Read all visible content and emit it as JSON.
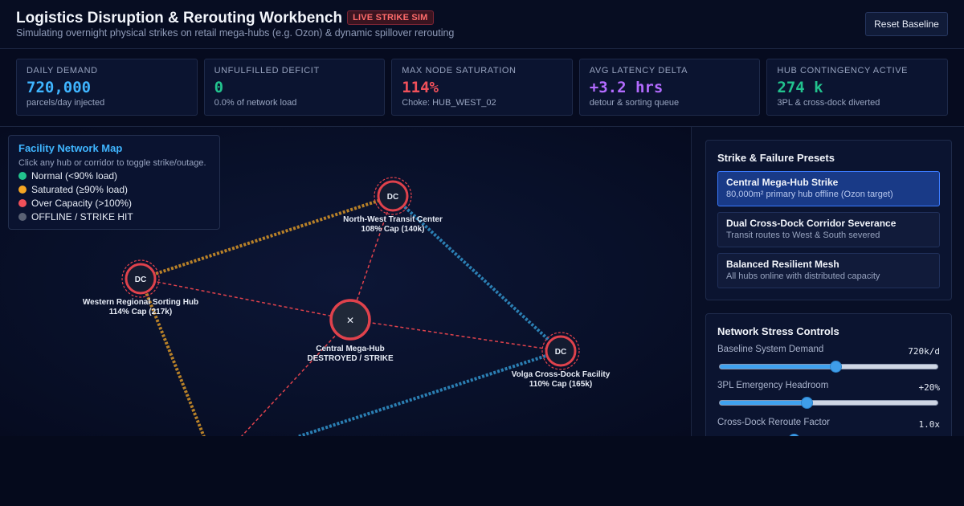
{
  "header": {
    "title": "Logistics Disruption & Rerouting Workbench",
    "badge": "LIVE STRIKE SIM",
    "subtitle": "Simulating overnight physical strikes on retail mega-hubs (e.g. Ozon) & dynamic spillover rerouting",
    "reset_label": "Reset Baseline"
  },
  "kpis": [
    {
      "label": "DAILY DEMAND",
      "value": "720,000",
      "sub": "parcels/day injected",
      "color": "#3fb5ff"
    },
    {
      "label": "UNFULFILLED DEFICIT",
      "value": "0",
      "sub": "0.0% of network load",
      "color": "#22c38e"
    },
    {
      "label": "MAX NODE SATURATION",
      "value": "114%",
      "sub": "Choke: HUB_WEST_02",
      "color": "#f0505a"
    },
    {
      "label": "AVG LATENCY DELTA",
      "value": "+3.2 hrs",
      "sub": "detour & sorting queue",
      "color": "#b36bff"
    },
    {
      "label": "HUB CONTINGENCY ACTIVE",
      "value": "274 k",
      "sub": "3PL & cross-dock diverted",
      "color": "#22c38e"
    }
  ],
  "legend": {
    "title": "Facility Network Map",
    "hint": "Click any hub or corridor to toggle strike/outage.",
    "items": [
      {
        "label": "Normal (<90% load)",
        "color": "#22c38e"
      },
      {
        "label": "Saturated (≥90% load)",
        "color": "#f5a623"
      },
      {
        "label": "Over Capacity (>100%)",
        "color": "#f0505a"
      },
      {
        "label": "OFFLINE / STRIKE HIT",
        "color": "#5a6275"
      }
    ]
  },
  "nodes": [
    {
      "id": "nw",
      "glyph": "DC",
      "name": "North-West Transit Center",
      "status": "108% Cap (140k)"
    },
    {
      "id": "west",
      "glyph": "DC",
      "name": "Western Regional Sorting Hub",
      "status": "114% Cap (217k)"
    },
    {
      "id": "central",
      "glyph": "✕",
      "name": "Central Mega-Hub",
      "status": "DESTROYED / STRIKE"
    },
    {
      "id": "volga",
      "glyph": "DC",
      "name": "Volga Cross-Dock Facility",
      "status": "110% Cap (165k)"
    }
  ],
  "presets": {
    "title": "Strike & Failure Presets",
    "items": [
      {
        "name": "Central Mega-Hub Strike",
        "desc": "80,000m² primary hub offline (Ozon target)",
        "active": true
      },
      {
        "name": "Dual Cross-Dock Corridor Severance",
        "desc": "Transit routes to West & South severed",
        "active": false
      },
      {
        "name": "Balanced Resilient Mesh",
        "desc": "All hubs online with distributed capacity",
        "active": false
      }
    ]
  },
  "controls": {
    "title": "Network Stress Controls",
    "sliders": [
      {
        "label": "Baseline System Demand",
        "value": "720k/d",
        "level": 0.53
      },
      {
        "label": "3PL Emergency Headroom",
        "value": "+20%",
        "level": 0.4
      },
      {
        "label": "Cross-Dock Reroute Factor",
        "value": "1.0x",
        "level": 0.34
      }
    ]
  }
}
